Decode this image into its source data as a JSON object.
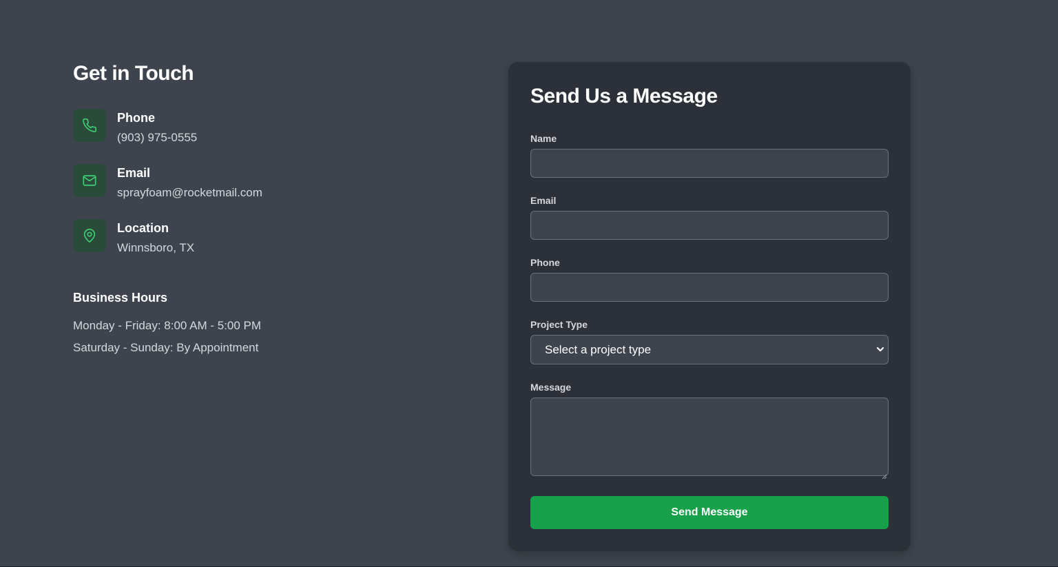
{
  "contact_info": {
    "title": "Get in Touch",
    "items": [
      {
        "label": "Phone",
        "value": "(903) 975-0555",
        "icon": "phone-icon"
      },
      {
        "label": "Email",
        "value": "sprayfoam@rocketmail.com",
        "icon": "mail-icon"
      },
      {
        "label": "Location",
        "value": "Winnsboro, TX",
        "icon": "map-pin-icon"
      }
    ],
    "hours": {
      "title": "Business Hours",
      "lines": [
        "Monday - Friday: 8:00 AM - 5:00 PM",
        "Saturday - Sunday: By Appointment"
      ]
    }
  },
  "form": {
    "title": "Send Us a Message",
    "fields": {
      "name": {
        "label": "Name",
        "value": ""
      },
      "email": {
        "label": "Email",
        "value": ""
      },
      "phone": {
        "label": "Phone",
        "value": ""
      },
      "project_type": {
        "label": "Project Type",
        "selected": "Select a project type"
      },
      "message": {
        "label": "Message",
        "value": ""
      }
    },
    "submit_label": "Send Message"
  },
  "colors": {
    "page_bg": "#3e444d",
    "card_bg": "#2c3038",
    "accent": "#17a14a",
    "icon_bg": "#2a4a3a",
    "icon_stroke": "#3ecf74"
  }
}
